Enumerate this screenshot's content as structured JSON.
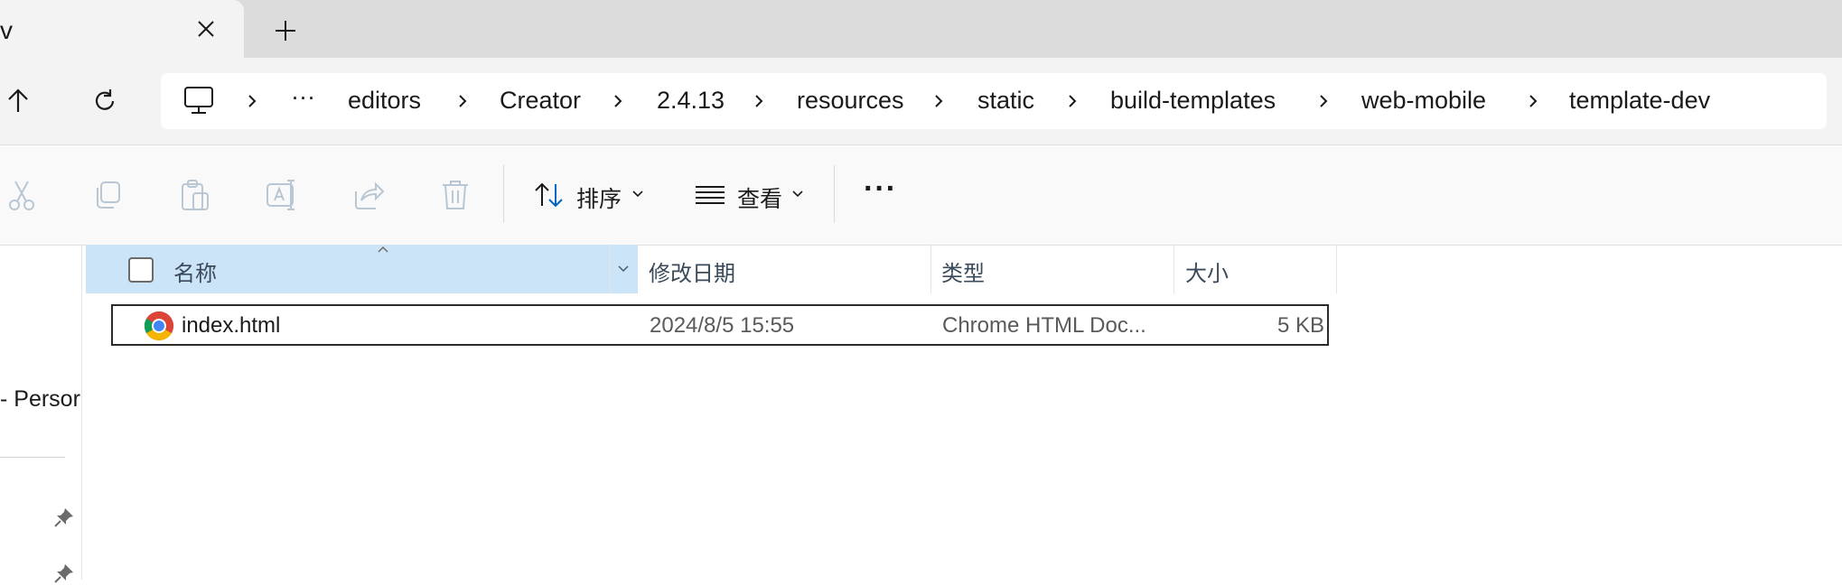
{
  "tab": {
    "title": "v"
  },
  "breadcrumb": {
    "more": "···",
    "items": [
      "editors",
      "Creator",
      "2.4.13",
      "resources",
      "static",
      "build-templates",
      "web-mobile",
      "template-dev"
    ]
  },
  "toolbar": {
    "sort_label": "排序",
    "view_label": "查看",
    "more_label": "···"
  },
  "navpane": {
    "item_label": "- Persor"
  },
  "columns": {
    "name": "名称",
    "modified": "修改日期",
    "type": "类型",
    "size": "大小"
  },
  "files": [
    {
      "name": "index.html",
      "modified": "2024/8/5 15:55",
      "type": "Chrome HTML Doc...",
      "size": "5 KB",
      "icon": "chrome-icon"
    }
  ],
  "colors": {
    "accent": "#0067c0",
    "header_selected": "#cce4f7"
  }
}
